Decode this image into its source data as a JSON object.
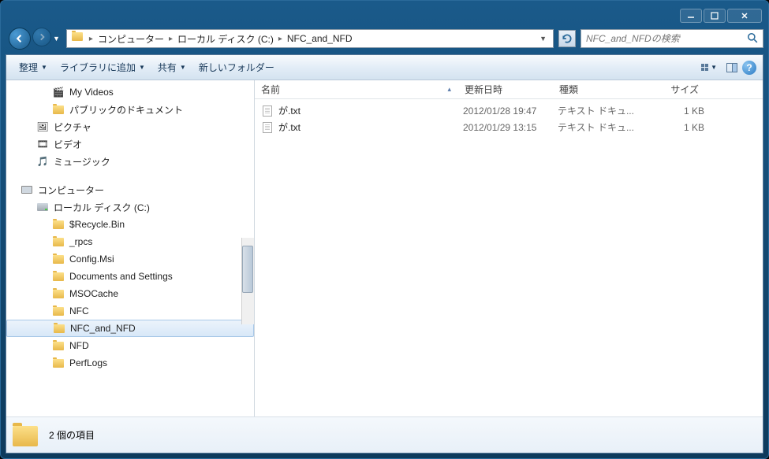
{
  "titlebar": {
    "minimize": "_",
    "maximize": "▢",
    "close": "✕"
  },
  "nav": {
    "breadcrumb": [
      {
        "label": "コンピューター"
      },
      {
        "label": "ローカル ディスク (C:)"
      },
      {
        "label": "NFC_and_NFD"
      }
    ],
    "search_placeholder": "NFC_and_NFDの検索"
  },
  "toolbar": {
    "organize": "整理",
    "add_to_library": "ライブラリに追加",
    "share": "共有",
    "new_folder": "新しいフォルダー"
  },
  "tree": {
    "my_videos": "My Videos",
    "public_docs": "パブリックのドキュメント",
    "pictures": "ピクチャ",
    "video": "ビデオ",
    "music": "ミュージック",
    "computer": "コンピューター",
    "local_disk": "ローカル ディスク (C:)",
    "folders": [
      "$Recycle.Bin",
      "_rpcs",
      "Config.Msi",
      "Documents and Settings",
      "MSOCache",
      "NFC",
      "NFC_and_NFD",
      "NFD",
      "PerfLogs"
    ]
  },
  "columns": {
    "name": "名前",
    "date": "更新日時",
    "type": "種類",
    "size": "サイズ"
  },
  "files": [
    {
      "name": "が.txt",
      "date": "2012/01/28 19:47",
      "type": "テキスト ドキュ...",
      "size": "1 KB"
    },
    {
      "name": "が.txt",
      "date": "2012/01/29 13:15",
      "type": "テキスト ドキュ...",
      "size": "1 KB"
    }
  ],
  "status": {
    "text": "2 個の項目"
  }
}
